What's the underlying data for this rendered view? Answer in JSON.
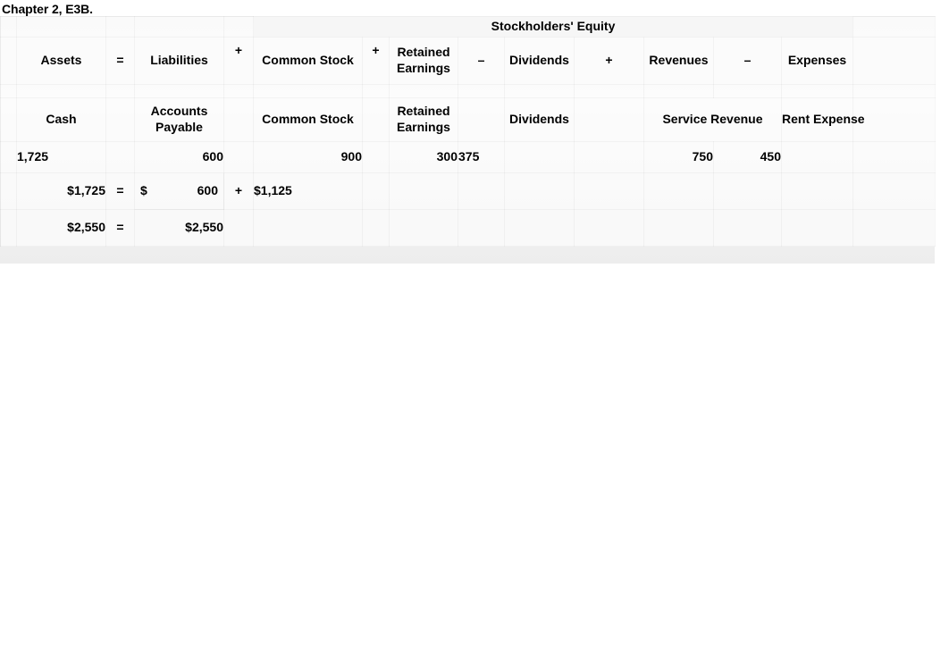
{
  "document": {
    "title": "Chapter 2, E3B."
  },
  "worksheet": {
    "equity_banner": "Stockholders' Equity",
    "equation_headers": {
      "assets": "Assets",
      "equals": "=",
      "liabilities": "Liabilities",
      "plus_equity": "+",
      "common_stock": "Common Stock",
      "plus_1": "+",
      "retained_earnings": "Retained Earnings",
      "minus_1": "–",
      "dividends": "Dividends",
      "plus_2": "+",
      "revenues": "Revenues",
      "minus_2": "–",
      "expenses": "Expenses"
    },
    "account_headers": {
      "cash": "Cash",
      "accounts_payable": "Accounts Payable",
      "common_stock": "Common Stock",
      "retained_earnings": "Retained Earnings",
      "dividends": "Dividends",
      "service_revenue": "Service Revenue",
      "rent_expense": "Rent Expense"
    },
    "balances": {
      "cash": "1,725",
      "accounts_payable": "600",
      "common_stock": "900",
      "retained_earnings": "300",
      "dividends": "375",
      "service_revenue": "750",
      "rent_expense": "450"
    },
    "proof_row_1": {
      "assets_total": "$1,725",
      "equals": "=",
      "liabilities_currency": "$",
      "liabilities_total": "600",
      "plus": "+",
      "equity_total": "$1,125"
    },
    "proof_row_2": {
      "left_total": "$2,550",
      "equals": "=",
      "right_total": "$2,550"
    }
  }
}
